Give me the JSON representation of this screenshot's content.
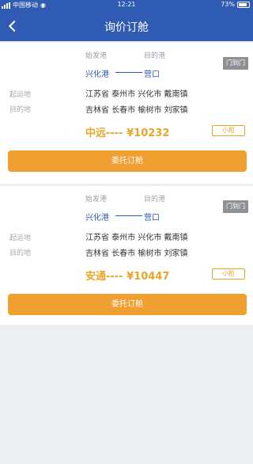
{
  "status": {
    "carrier": "中国移动",
    "time": "12:21",
    "battery": "73%"
  },
  "header": {
    "title": "询价订舱"
  },
  "columns": {
    "start": "始发港",
    "end": "目的港"
  },
  "labels": {
    "from": "起运地",
    "to": "目的地"
  },
  "quotes": [
    {
      "port_start": "兴化港",
      "port_end": "营口",
      "tag": "门到门",
      "from_address": "江苏省 泰州市 兴化市 戴南镇",
      "to_address": "吉林省 长春市 榆树市 刘家镇",
      "price_line": "中远---- ¥10232",
      "outline_tag": "小柜",
      "button": "委托订舱"
    },
    {
      "port_start": "兴化港",
      "port_end": "营口",
      "tag": "门到门",
      "from_address": "江苏省 泰州市 兴化市 戴南镇",
      "to_address": "吉林省 长春市 榆树市 刘家镇",
      "price_line": "安通---- ¥10447",
      "outline_tag": "小柜",
      "button": "委托订舱"
    }
  ],
  "colors": {
    "brand": "#2f5bb2",
    "accent": "#f0a030",
    "price": "#e8a629"
  }
}
